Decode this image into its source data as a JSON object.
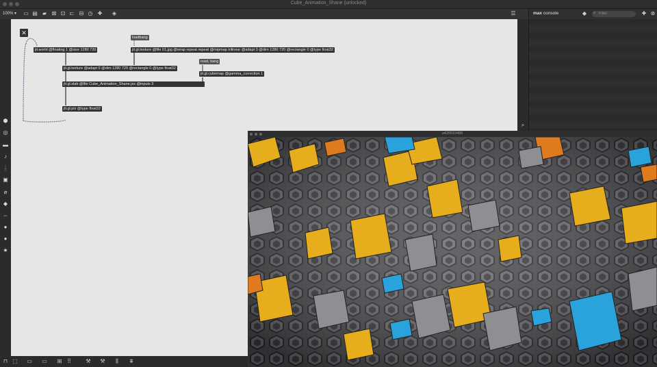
{
  "window": {
    "title": "Cube_Animation_Shane (unlocked)"
  },
  "toolbar": {
    "zoom": "100% ▾"
  },
  "patcher": {
    "close_label": "✕",
    "objects": [
      {
        "text": "jit.world @floating 1 @size 1280 720"
      },
      {
        "text": "loadbang"
      },
      {
        "text": "jit.gl.texture @file 01.jpg @wrap repeat repeat @mipmap trilinear @adapt 0 @dim 1280 720 @rectangle 0 @type float32"
      },
      {
        "text": "read, bang"
      },
      {
        "text": "jit.gl.texture @adapt 0 @dim 1280 720 @rectangle 0 @type float32"
      },
      {
        "text": "jit.gl.cubemap @gamma_correction 1"
      },
      {
        "text": "jit.gl.slab @file Cube_Animation_Shane.jxs @inputs 3"
      },
      {
        "text": "jit.gl.pix @type float32"
      }
    ]
  },
  "console": {
    "title_bold": "max",
    "title_rest": " console",
    "filter_placeholder": "Filter"
  },
  "viewer": {
    "title": "u420010485"
  },
  "colors": {
    "canvas": "#e6e6e6",
    "object": "#333333",
    "yellow": "#e6ad1c",
    "orange": "#e07a1f",
    "blue": "#2aa2dc"
  }
}
